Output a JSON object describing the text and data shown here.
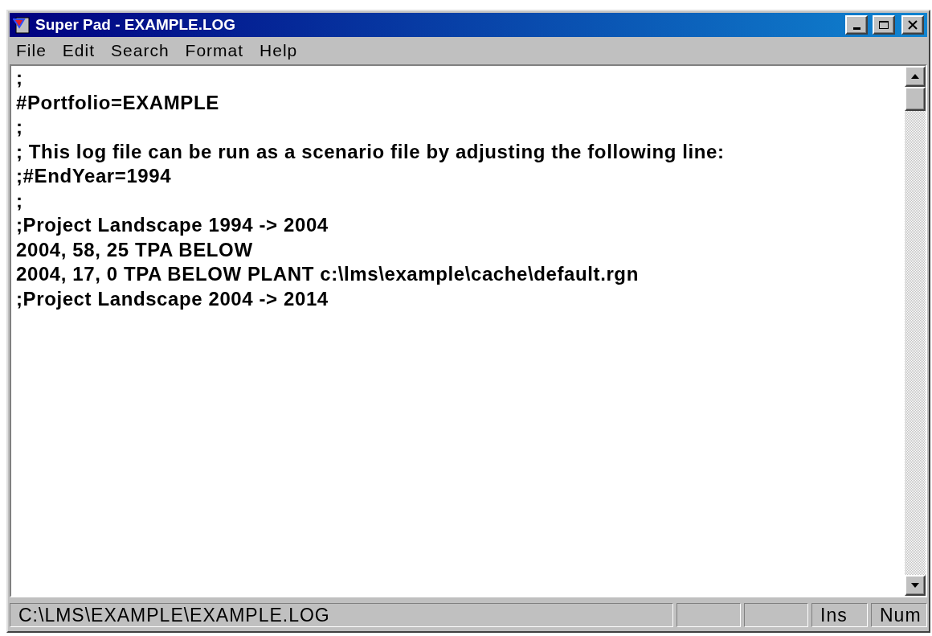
{
  "window": {
    "title": "Super Pad - EXAMPLE.LOG"
  },
  "menu": [
    "File",
    "Edit",
    "Search",
    "Format",
    "Help"
  ],
  "editor": {
    "lines": [
      ";",
      "#Portfolio=EXAMPLE",
      ";",
      "; This log file can be run as a scenario file by adjusting the following line:",
      ";#EndYear=1994",
      ";",
      ";Project Landscape 1994 -> 2004",
      "2004, 58, 25 TPA BELOW",
      "2004, 17, 0 TPA BELOW PLANT c:\\lms\\example\\cache\\default.rgn",
      ";Project Landscape 2004 -> 2014"
    ]
  },
  "status_bar": {
    "path": "C:\\LMS\\EXAMPLE\\EXAMPLE.LOG",
    "indicators": [
      "Ins",
      "Num"
    ]
  }
}
